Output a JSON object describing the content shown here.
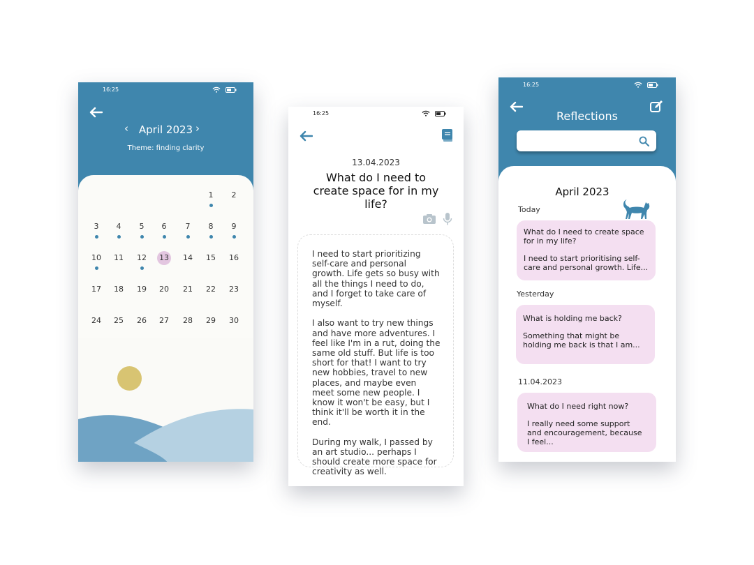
{
  "calendar_screen": {
    "time": "16:25",
    "month": "April 2023",
    "theme": "Theme: finding clarity",
    "days": [
      {
        "d": "1",
        "dot": true
      },
      {
        "d": "2",
        "dot": false
      },
      {
        "d": "3",
        "dot": true
      },
      {
        "d": "4",
        "dot": true
      },
      {
        "d": "5",
        "dot": true
      },
      {
        "d": "6",
        "dot": true
      },
      {
        "d": "7",
        "dot": true
      },
      {
        "d": "8",
        "dot": true
      },
      {
        "d": "9",
        "dot": true
      },
      {
        "d": "10",
        "dot": true
      },
      {
        "d": "11",
        "dot": false
      },
      {
        "d": "12",
        "dot": true
      },
      {
        "d": "13",
        "dot": false,
        "selected": true
      },
      {
        "d": "14",
        "dot": false
      },
      {
        "d": "15",
        "dot": false
      },
      {
        "d": "16",
        "dot": false
      },
      {
        "d": "17",
        "dot": false
      },
      {
        "d": "18",
        "dot": false
      },
      {
        "d": "19",
        "dot": false
      },
      {
        "d": "20",
        "dot": false
      },
      {
        "d": "21",
        "dot": false
      },
      {
        "d": "22",
        "dot": false
      },
      {
        "d": "23",
        "dot": false
      },
      {
        "d": "24",
        "dot": false
      },
      {
        "d": "25",
        "dot": false
      },
      {
        "d": "26",
        "dot": false
      },
      {
        "d": "27",
        "dot": false
      },
      {
        "d": "28",
        "dot": false
      },
      {
        "d": "29",
        "dot": false
      },
      {
        "d": "30",
        "dot": false
      }
    ]
  },
  "entry_screen": {
    "time": "16:25",
    "date": "13.04.2023",
    "question": "What do I need to create space for in my life?",
    "paragraphs": [
      "I need to start prioritizing self-care and personal growth. Life gets so busy with all the things I need to do, and I forget to take care of myself.",
      "I also want to try new things and have more adventures. I feel like I'm in a rut, doing the same old stuff. But life is too short for that! I want to try new hobbies, travel to new places, and maybe even meet some new people. I know it won't be easy, but I think it'll be worth it in the end.",
      "During my walk, I passed by an art studio... perhaps I should create more space for creativity as well."
    ]
  },
  "reflections_screen": {
    "time": "16:25",
    "title": "Reflections",
    "search_placeholder": "",
    "month": "April 2023",
    "groups": [
      {
        "label": "Today",
        "question": "What do I need to create space for in my life?",
        "preview": "I need to start prioritising self-care and personal growth. Life..."
      },
      {
        "label": "Yesterday",
        "question": "What is holding me back?",
        "preview": "Something that might be holding me back is that I am..."
      },
      {
        "label": "11.04.2023",
        "question": "What do I need right now?",
        "preview": "I really need some support and encouragement, because I feel..."
      }
    ]
  },
  "colors": {
    "primary": "#3f86ad",
    "card": "#f4dff1",
    "selected": "#e3c6e0",
    "sun": "#d8c472"
  }
}
